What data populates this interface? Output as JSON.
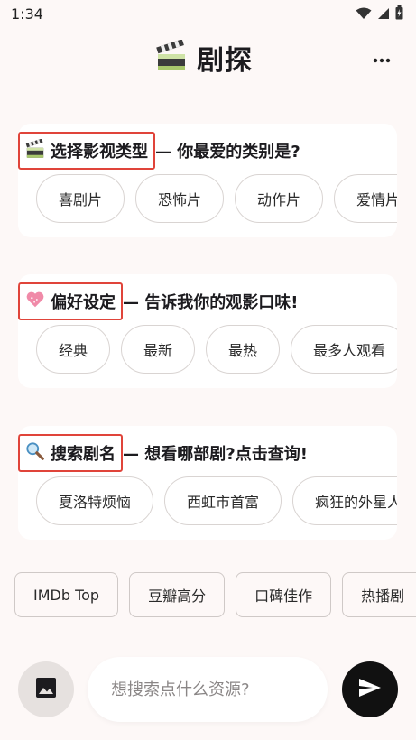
{
  "status_bar": {
    "time": "1:34",
    "icons": [
      "wifi-icon",
      "signal-icon",
      "battery-icon"
    ]
  },
  "header": {
    "icon": "clapperboard-icon",
    "title": "剧探",
    "menu_icon": "more-dots-icon"
  },
  "sections": [
    {
      "icon": "clapperboard-icon",
      "badge": "选择影视类型",
      "suffix": "— 你最爱的类别是?",
      "chips": [
        "喜剧片",
        "恐怖片",
        "动作片",
        "爱情片"
      ]
    },
    {
      "icon": "sparkling-heart-icon",
      "badge": "偏好设定",
      "suffix": "— 告诉我你的观影口味!",
      "chips": [
        "经典",
        "最新",
        "最热",
        "最多人观看"
      ]
    },
    {
      "icon": "magnifier-icon",
      "badge": "搜索剧名",
      "suffix": "— 想看哪部剧?点击查询!",
      "chips": [
        "夏洛特烦恼",
        "西虹市首富",
        "疯狂的外星人"
      ]
    }
  ],
  "quick_filters": [
    "IMDb Top",
    "豆瓣高分",
    "口碑佳作",
    "热播剧"
  ],
  "bottom_bar": {
    "image_icon": "image-icon",
    "placeholder": "想搜索点什么资源?",
    "send_icon": "send-icon"
  },
  "colors": {
    "background": "#fdf8f7",
    "badge_outline": "#e0443a",
    "send_button": "#111111"
  }
}
